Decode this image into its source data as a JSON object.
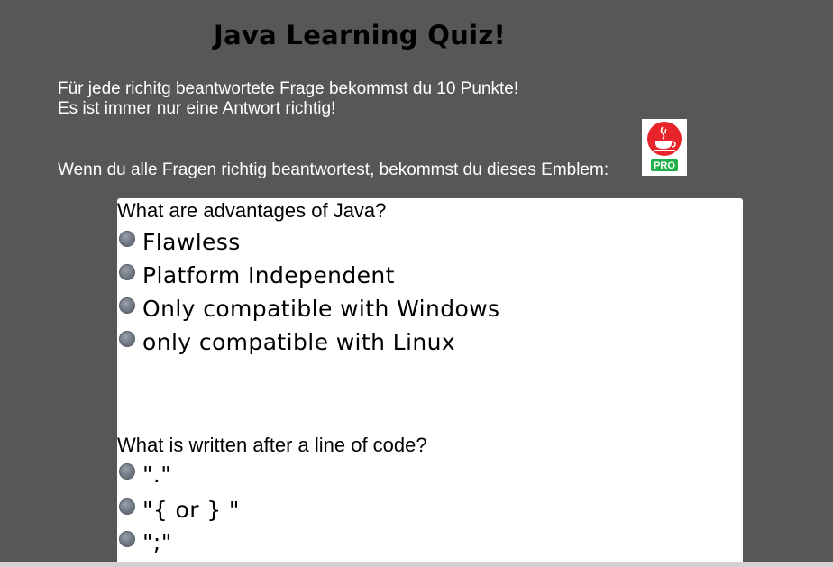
{
  "header": {
    "title": "Java Learning Quiz!"
  },
  "intro": {
    "line1": "Für jede richitg beantwortete Frage bekommst du 10 Punkte!",
    "line2": "Es ist immer nur eine Antwort richtig!",
    "emblem_text": "Wenn du alle Fragen richtig beantwortest, bekommst du dieses Emblem:"
  },
  "emblem": {
    "icon": "java-cup-icon",
    "badge": "PRO",
    "colors": {
      "circle": "#e8242b",
      "badge": "#21b14b"
    }
  },
  "questions": [
    {
      "text": "What are advantages of Java?",
      "options": [
        "Flawless",
        "Platform Independent",
        "Only compatible with Windows",
        "only compatible with Linux"
      ]
    },
    {
      "text": "What is written after a line of code?",
      "options": [
        "\".\"",
        "\"{ or } \"",
        "\";\""
      ]
    }
  ],
  "colors": {
    "background": "#575757",
    "card": "#ffffff",
    "radio": "#6f7783"
  }
}
